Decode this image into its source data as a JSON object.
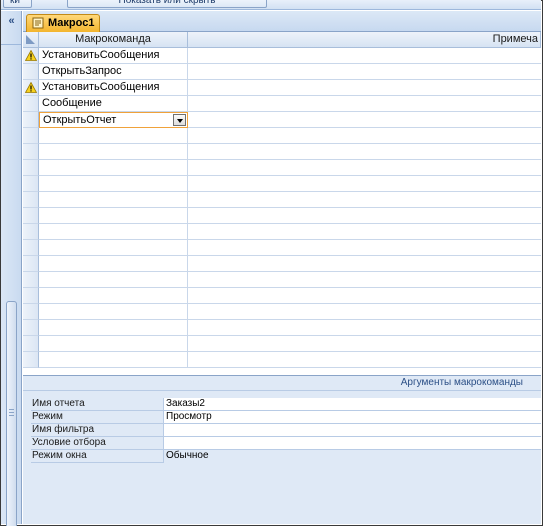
{
  "ribbon": {
    "left_button": "ки",
    "show_hide_button": "Показать или скрыть"
  },
  "nav_pane": {
    "toggle_glyph": "«",
    "toggle_icon": "double-chevron-left-icon"
  },
  "document_tab": {
    "title": "Макрос1",
    "icon": "macro-icon"
  },
  "grid": {
    "headers": {
      "action": "Макрокоманда",
      "comment": "Примеча"
    },
    "rows": [
      {
        "action": "УстановитьСообщения",
        "warning": true
      },
      {
        "action": "ОткрытьЗапрос",
        "warning": false
      },
      {
        "action": "УстановитьСообщения",
        "warning": true
      },
      {
        "action": "Сообщение",
        "warning": false
      },
      {
        "action": "ОткрытьОтчет",
        "warning": false,
        "active": true
      }
    ],
    "blank_row_count": 15
  },
  "arguments": {
    "title": "Аргументы макрокоманды",
    "rows": [
      {
        "label": "Имя отчета",
        "value": "Заказы2"
      },
      {
        "label": "Режим",
        "value": "Просмотр"
      },
      {
        "label": "Имя фильтра",
        "value": ""
      },
      {
        "label": "Условие отбора",
        "value": ""
      },
      {
        "label": "Режим окна",
        "value": "Обычное"
      }
    ]
  },
  "colors": {
    "accent_tab": "#f3b52e",
    "warning": "#f7d21e",
    "active_cell_border": "#f0a23a"
  }
}
